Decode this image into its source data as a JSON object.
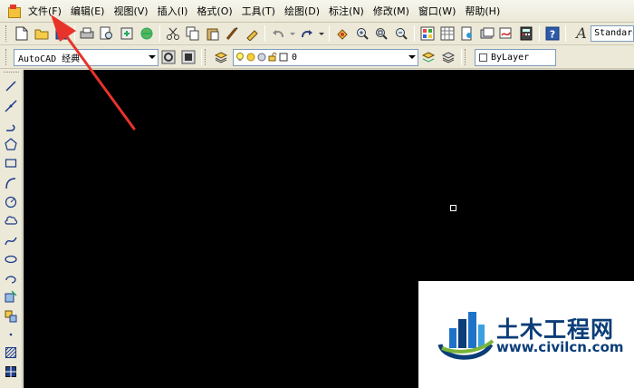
{
  "menubar": {
    "items": [
      {
        "name": "menu-file",
        "label": "文件(F)"
      },
      {
        "name": "menu-edit",
        "label": "编辑(E)"
      },
      {
        "name": "menu-view",
        "label": "视图(V)"
      },
      {
        "name": "menu-insert",
        "label": "插入(I)"
      },
      {
        "name": "menu-format",
        "label": "格式(O)"
      },
      {
        "name": "menu-tools",
        "label": "工具(T)"
      },
      {
        "name": "menu-draw",
        "label": "绘图(D)"
      },
      {
        "name": "menu-dimension",
        "label": "标注(N)"
      },
      {
        "name": "menu-modify",
        "label": "修改(M)"
      },
      {
        "name": "menu-window",
        "label": "窗口(W)"
      },
      {
        "name": "menu-help",
        "label": "帮助(H)"
      }
    ]
  },
  "standard_toolbar": {
    "text_style_value": "Standard"
  },
  "workspace_toolbar": {
    "workspace_value": "AutoCAD 经典",
    "layer_value": "0",
    "color_value": "ByLayer"
  },
  "watermark": {
    "title": "土木工程网",
    "url": "www.civilcn.com"
  },
  "colors": {
    "canvas_bg": "#000000",
    "annotation_arrow": "#e8332a",
    "watermark_text": "#0b3d78"
  }
}
